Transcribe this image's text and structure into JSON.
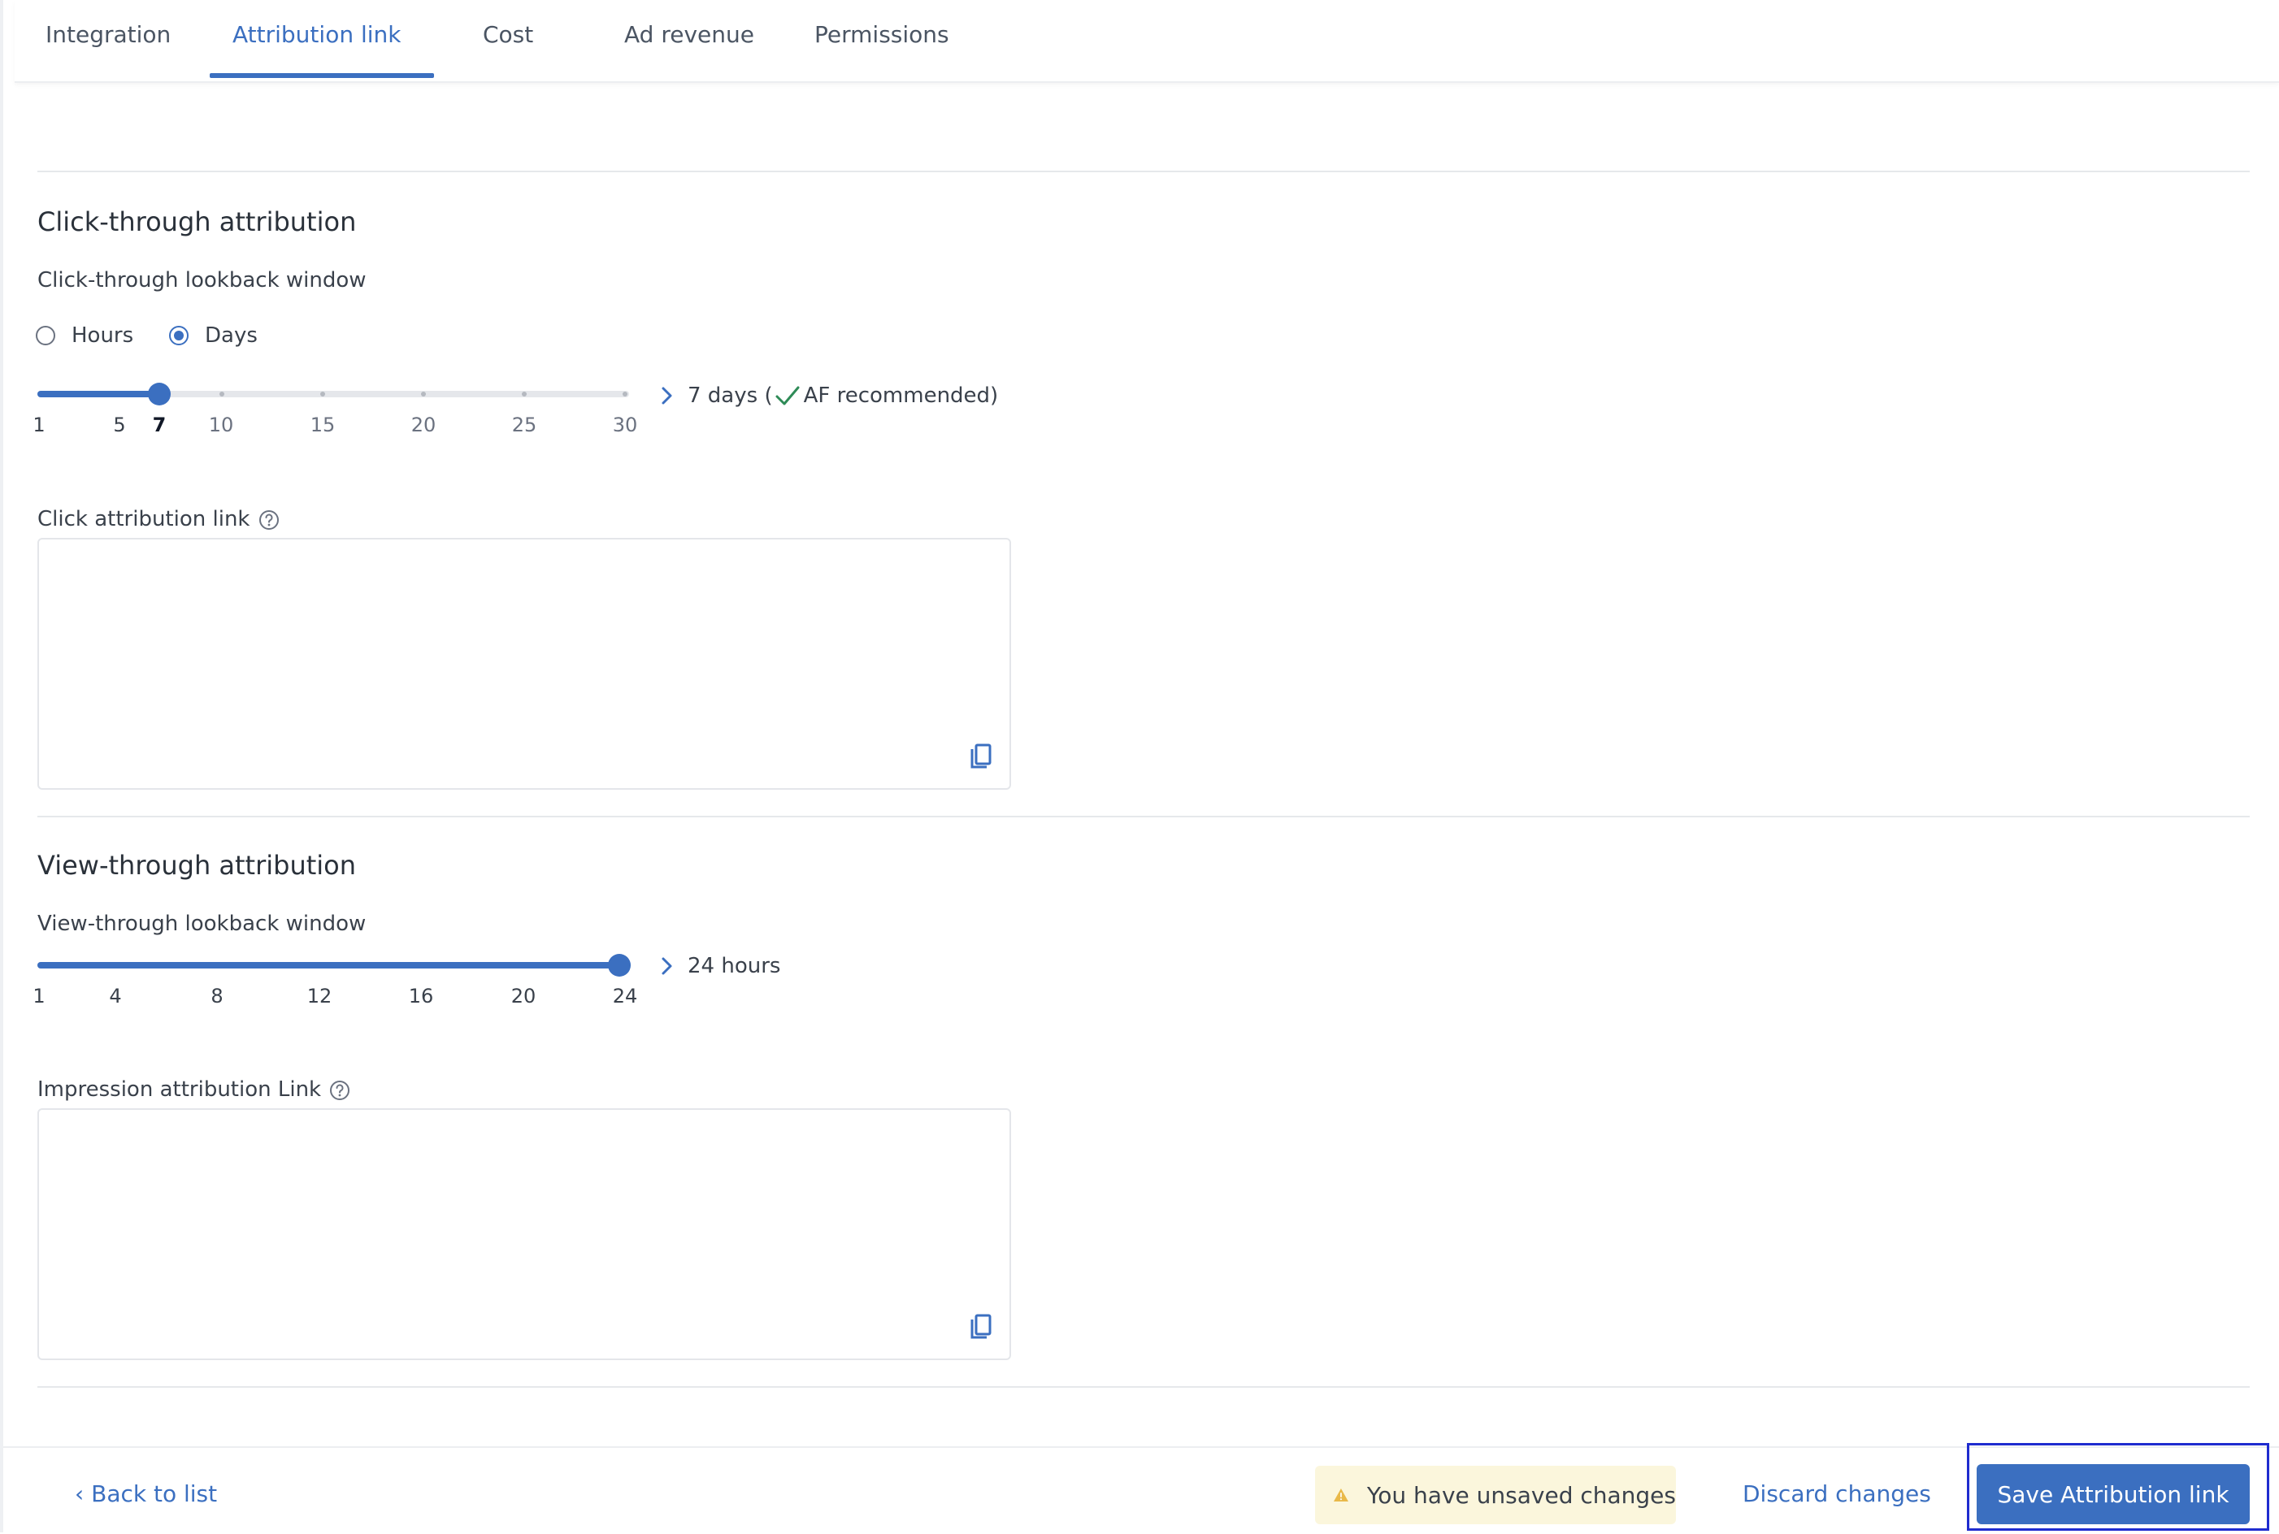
{
  "tabs": [
    {
      "label": "Integration",
      "active": false
    },
    {
      "label": "Attribution link",
      "active": true
    },
    {
      "label": "Cost",
      "active": false
    },
    {
      "label": "Ad revenue",
      "active": false
    },
    {
      "label": "Permissions",
      "active": false
    }
  ],
  "click_through": {
    "title": "Click-through attribution",
    "window_label": "Click-through lookback window",
    "unit_options": [
      {
        "label": "Hours",
        "selected": false
      },
      {
        "label": "Days",
        "selected": true
      }
    ],
    "slider": {
      "min": 1,
      "max": 30,
      "value": 7,
      "ticks": [
        "1",
        "5",
        "7",
        "10",
        "15",
        "20",
        "25",
        "30"
      ],
      "tick_values": [
        1,
        5,
        7,
        10,
        15,
        20,
        25,
        30
      ]
    },
    "readout_prefix": "7 days (",
    "readout_recommended": "AF recommended)",
    "link_label": "Click attribution link",
    "link_value": ""
  },
  "view_through": {
    "title": "View-through attribution",
    "window_label": "View-through lookback window",
    "slider": {
      "min": 1,
      "max": 24,
      "value": 24,
      "ticks": [
        "1",
        "4",
        "8",
        "12",
        "16",
        "20",
        "24"
      ],
      "tick_values": [
        1,
        4,
        8,
        12,
        16,
        20,
        24
      ]
    },
    "readout": "24 hours",
    "link_label": "Impression attribution Link",
    "link_value": ""
  },
  "footer": {
    "back_label": "Back to list",
    "unsaved_text": "You have unsaved changes",
    "discard_label": "Discard changes",
    "save_label": "Save Attribution link"
  },
  "colors": {
    "accent": "#3b6fc0",
    "recommended_check": "#2e8b57",
    "warning_bg": "#fbf6dc",
    "warning_icon": "#e9b949"
  }
}
